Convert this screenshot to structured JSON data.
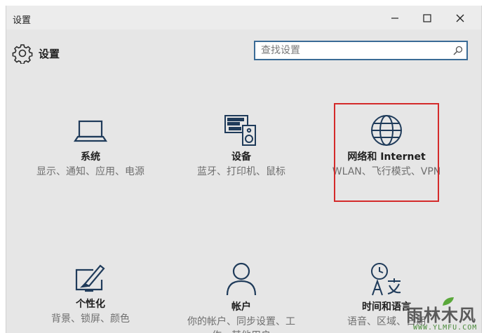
{
  "window": {
    "title": "设置",
    "controls": {
      "minimize": "minimize",
      "maximize": "maximize",
      "close": "close"
    }
  },
  "header": {
    "title": "设置",
    "search": {
      "placeholder": "查找设置",
      "value": ""
    }
  },
  "tiles": [
    {
      "label": "系统",
      "desc": "显示、通知、应用、电源",
      "icon": "laptop-icon"
    },
    {
      "label": "设备",
      "desc": "蓝牙、打印机、鼠标",
      "icon": "devices-icon"
    },
    {
      "label": "网络和 Internet",
      "desc": "WLAN、飞行模式、VPN",
      "icon": "globe-icon"
    },
    {
      "label": "个性化",
      "desc": "背景、锁屏、颜色",
      "icon": "personalization-icon"
    },
    {
      "label": "帐户",
      "desc": "你的帐户、同步设置、工作、其他用户",
      "icon": "person-icon"
    },
    {
      "label": "时间和语言",
      "desc": "语音、区域、日期",
      "icon": "time-language-icon"
    }
  ],
  "colors": {
    "accent": "#3a6b96",
    "highlight": "#d42a2a",
    "background": "#e6e6e6"
  },
  "watermark": {
    "main": "雨林木风",
    "sub": "WWW.YLMFU.COM"
  }
}
